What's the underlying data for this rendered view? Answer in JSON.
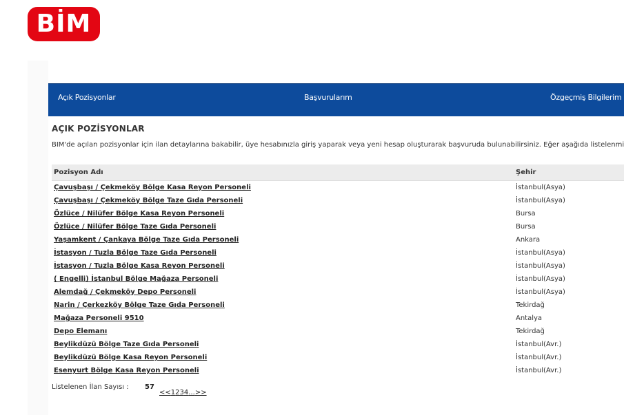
{
  "logo": {
    "text": "BİM",
    "color": "#e30613"
  },
  "nav": {
    "color": "#0d4b9c",
    "items": [
      {
        "label": "Açık Pozisyonlar"
      },
      {
        "label": "Başvurularım"
      },
      {
        "label": "Özgeçmiş Bilgilerim"
      }
    ]
  },
  "page": {
    "title": "AÇIK POZİSYONLAR",
    "description": "BİM'de açılan pozisyonlar için ilan detaylarına bakabilir, üye hesabınızla giriş yaparak veya yeni hesap oluşturarak başvuruda bulunabilirsiniz. Eğer aşağıda listelenmiş olan a"
  },
  "table": {
    "columns": [
      "Pozisyon Adı",
      "Şehir"
    ],
    "rows": [
      {
        "position": "Çavuşbaşı / Çekmeköy Bölge Kasa Reyon Personeli",
        "city": "İstanbul(Asya)"
      },
      {
        "position": "Çavuşbaşı / Çekmeköy Bölge Taze Gıda Personeli",
        "city": "İstanbul(Asya)"
      },
      {
        "position": "Özlüce / Nilüfer Bölge Kasa Reyon Personeli",
        "city": "Bursa"
      },
      {
        "position": "Özlüce / Nilüfer Bölge Taze Gıda Personeli",
        "city": "Bursa"
      },
      {
        "position": "Yaşamkent / Çankaya Bölge Taze Gıda Personeli",
        "city": "Ankara"
      },
      {
        "position": "İstasyon / Tuzla Bölge Taze Gıda Personeli",
        "city": "İstanbul(Asya)"
      },
      {
        "position": "İstasyon / Tuzla Bölge Kasa Reyon Personeli",
        "city": "İstanbul(Asya)"
      },
      {
        "position": "( Engelli) İstanbul Bölge Mağaza Personeli",
        "city": "İstanbul(Asya)"
      },
      {
        "position": "Alemdağ / Çekmeköy Depo Personeli",
        "city": "İstanbul(Asya)"
      },
      {
        "position": "Narin / Çerkezköy Bölge Taze Gıda Personeli",
        "city": "Tekirdağ"
      },
      {
        "position": "Mağaza Personeli 9510",
        "city": "Antalya"
      },
      {
        "position": "Depo Elemanı",
        "city": "Tekirdağ"
      },
      {
        "position": "Beylikdüzü Bölge Taze Gıda Personeli",
        "city": "İstanbul(Avr.)"
      },
      {
        "position": "Beylikdüzü Bölge Kasa Reyon Personeli",
        "city": "İstanbul(Avr.)"
      },
      {
        "position": "Esenyurt Bölge Kasa Reyon Personeli",
        "city": "İstanbul(Avr.)"
      }
    ]
  },
  "footer": {
    "count_label": "Listelenen İlan Sayısı :",
    "count": "57",
    "pager": {
      "first": "<<",
      "pages": [
        "1",
        "2",
        "3",
        "4"
      ],
      "ellipsis": "...",
      "last": ">>"
    }
  }
}
